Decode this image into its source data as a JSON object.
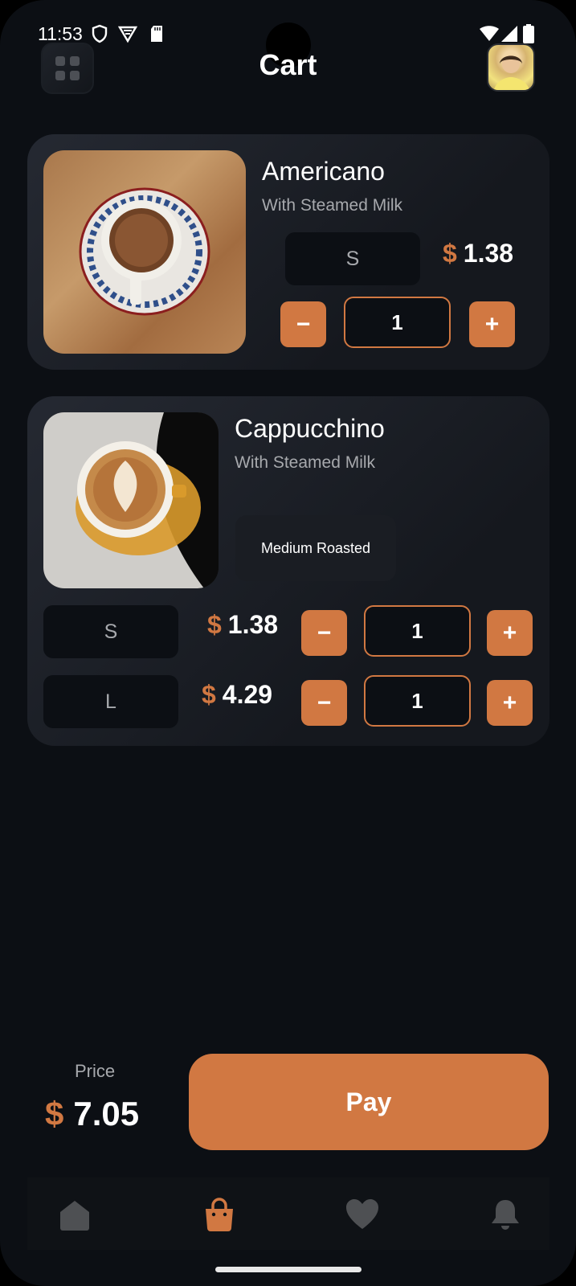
{
  "status_bar": {
    "time": "11:53"
  },
  "header": {
    "title": "Cart"
  },
  "items": [
    {
      "name": "Americano",
      "subtitle": "With Steamed Milk",
      "sizes": [
        {
          "size": "S",
          "currency": "$",
          "price": "1.38",
          "quantity": "1"
        }
      ]
    },
    {
      "name": "Cappucchino",
      "subtitle": "With Steamed Milk",
      "roast": "Medium Roasted",
      "sizes": [
        {
          "size": "S",
          "currency": "$",
          "price": "1.38",
          "quantity": "1"
        },
        {
          "size": "L",
          "currency": "$",
          "price": "4.29",
          "quantity": "1"
        }
      ]
    }
  ],
  "controls": {
    "minus": "−",
    "plus": "+"
  },
  "footer": {
    "price_label": "Price",
    "currency": "$",
    "total": "7.05",
    "pay_label": "Pay"
  },
  "colors": {
    "accent": "#D17842",
    "background": "#0C0F14",
    "card": "#252932"
  },
  "nav": [
    "home-icon",
    "bag-icon",
    "heart-icon",
    "bell-icon"
  ]
}
